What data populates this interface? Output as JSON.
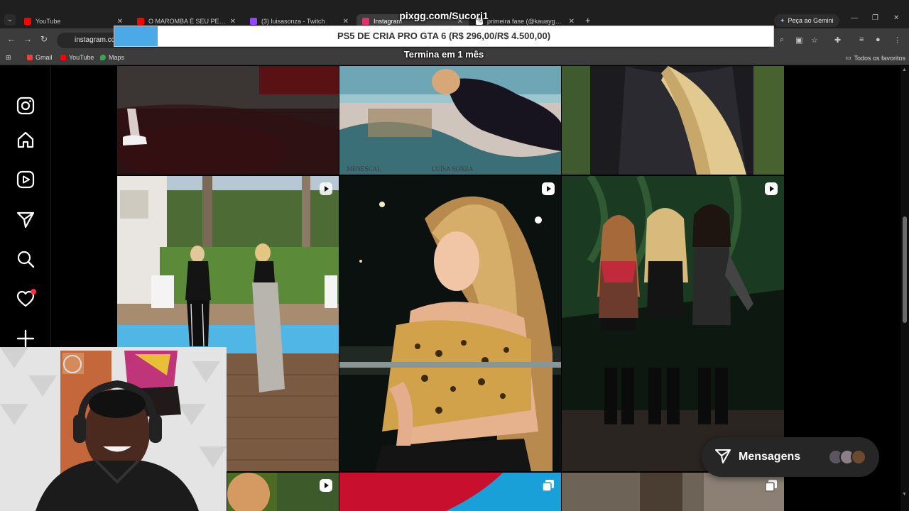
{
  "browser": {
    "tabs": [
      {
        "title": "YouTube",
        "color": "#ff0000",
        "active": false
      },
      {
        "title": "O MAROMBA É SEU PERSONAL",
        "color": "#ff0000",
        "active": false
      },
      {
        "title": "(3) luisasonza - Twitch",
        "color": "#9146ff",
        "active": false
      },
      {
        "title": "Instagram",
        "color": "#e1306c",
        "active": true
      },
      {
        "title": "primeira fase (@kauaygod) / X",
        "color": "#ffffff",
        "active": false
      }
    ],
    "gemini_label": "Peça ao Gemini",
    "address": "instagram.com",
    "bookmarks": [
      {
        "label": "Gmail",
        "color": "#ea4335"
      },
      {
        "label": "YouTube",
        "color": "#ff0000"
      },
      {
        "label": "Maps",
        "color": "#34a853"
      }
    ],
    "all_bookmarks_label": "Todos os favoritos"
  },
  "overlay": {
    "donation_url": "pixgg.com/Sucorj1",
    "goal_text": "PS5 DE CRIA PRO GTA 6 (R$ 296,00/R$ 4.500,00)",
    "goal_progress": 0.066,
    "goal_ends": "Termina em 1 mês"
  },
  "instagram": {
    "sidebar": [
      "instagram-logo",
      "home",
      "reels",
      "direct",
      "search",
      "notifications",
      "create"
    ],
    "messages_label": "Mensagens",
    "post_captions": {
      "watermark_left": "MENESCAL",
      "watermark_right": "LUÍSA SONZA"
    }
  },
  "colors": {
    "accent": "#4aa9e6",
    "notification": "#ff3040"
  }
}
